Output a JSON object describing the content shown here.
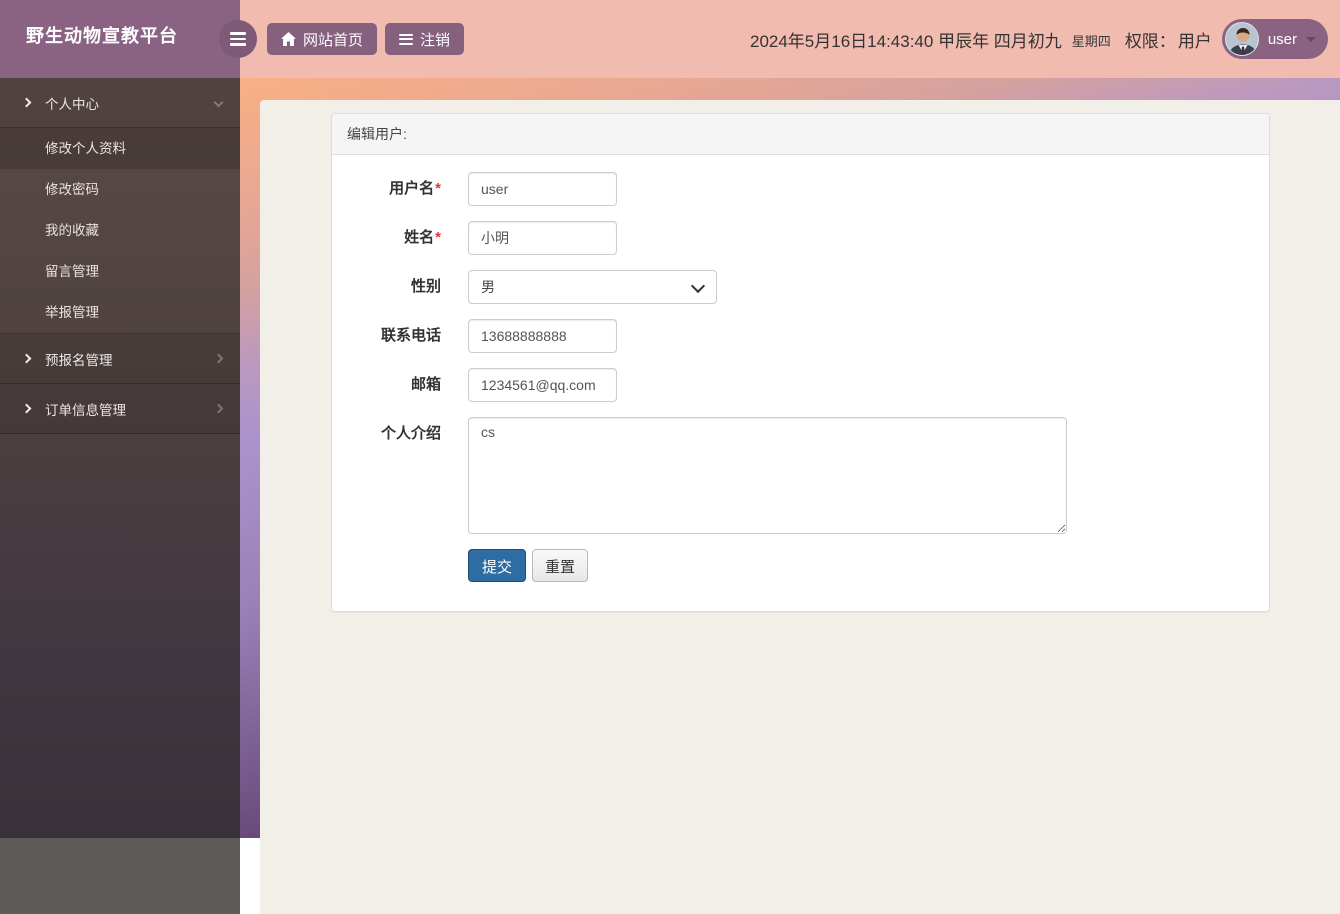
{
  "app": {
    "title": "野生动物宣教平台"
  },
  "topbar": {
    "nav": [
      {
        "label": "网站首页",
        "icon": "home-icon"
      },
      {
        "label": "注销",
        "icon": "list-icon"
      }
    ],
    "datetime": "2024年5月16日14:43:40 甲辰年 四月初九",
    "weekday": "星期四",
    "permission_label": "权限：",
    "permission_value": "用户",
    "username": "user"
  },
  "sidebar": {
    "items": [
      {
        "label": "个人中心",
        "type": "section",
        "state": "expanded"
      },
      {
        "label": "修改个人资料",
        "type": "subitem",
        "active": true
      },
      {
        "label": "修改密码",
        "type": "subitem",
        "active": false
      },
      {
        "label": "我的收藏",
        "type": "subitem",
        "active": false
      },
      {
        "label": "留言管理",
        "type": "subitem",
        "active": false
      },
      {
        "label": "举报管理",
        "type": "subitem",
        "active": false
      },
      {
        "label": "预报名管理",
        "type": "section",
        "state": "collapsed"
      },
      {
        "label": "订单信息管理",
        "type": "section",
        "state": "collapsed"
      }
    ]
  },
  "form": {
    "title": "编辑用户:",
    "fields": [
      {
        "label": "用户名",
        "required_mark": "*",
        "type": "text",
        "value": "user"
      },
      {
        "label": "姓名",
        "required_mark": "*",
        "type": "text",
        "value": "小明"
      },
      {
        "label": "性别",
        "required_mark": "",
        "type": "select",
        "value": "男"
      },
      {
        "label": "联系电话",
        "required_mark": "",
        "type": "text",
        "value": "13688888888"
      },
      {
        "label": "邮箱",
        "required_mark": "",
        "type": "text",
        "value": "1234561@qq.com"
      },
      {
        "label": "个人介绍",
        "required_mark": "",
        "type": "textarea",
        "value": "cs"
      }
    ],
    "submit_label": "提交",
    "reset_label": "重置"
  },
  "colors": {
    "accent_purple": "#8a6383",
    "topbar_pink": "#f2bbb0",
    "sidebar_dark": "#493c3b",
    "content_beige": "#f1efe8",
    "submit_blue": "#2e6da4",
    "required_red": "#d9342b"
  }
}
